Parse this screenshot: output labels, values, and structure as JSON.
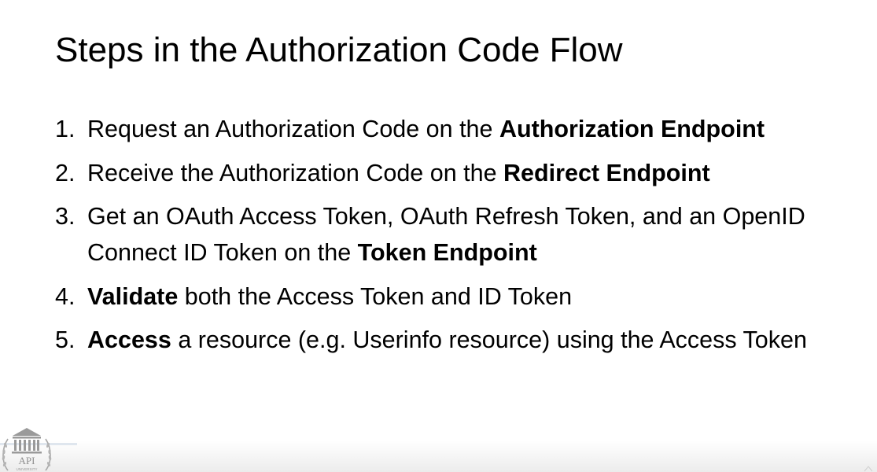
{
  "slide": {
    "title": "Steps in the Authorization Code Flow",
    "steps": [
      {
        "number": "1.",
        "parts": [
          {
            "text": "Request an Authorization Code on the ",
            "bold": false
          },
          {
            "text": "Authorization Endpoint",
            "bold": true
          }
        ]
      },
      {
        "number": "2.",
        "parts": [
          {
            "text": "Receive the Authorization Code on the ",
            "bold": false
          },
          {
            "text": "Redirect Endpoint",
            "bold": true
          }
        ]
      },
      {
        "number": "3.",
        "parts": [
          {
            "text": "Get an OAuth Access Token, OAuth Refresh Token, and an OpenID Connect ID Token on the ",
            "bold": false
          },
          {
            "text": "Token Endpoint",
            "bold": true
          }
        ]
      },
      {
        "number": "4.",
        "parts": [
          {
            "text": "Validate",
            "bold": true
          },
          {
            "text": " both the Access Token and ID Token",
            "bold": false
          }
        ]
      },
      {
        "number": "5.",
        "parts": [
          {
            "text": "Access",
            "bold": true
          },
          {
            "text": " a resource (e.g. Userinfo resource) using the Access Token",
            "bold": false
          }
        ]
      }
    ]
  },
  "logo": {
    "icon": "api-university-logo",
    "text": "API",
    "subtext": "UNIVERSITY",
    "color": "#9a9a9a"
  },
  "colors": {
    "background": "#ffffff",
    "text": "#000000",
    "footer_gradient_end": "#ececec",
    "footer_accent": "#dfe6ee"
  }
}
